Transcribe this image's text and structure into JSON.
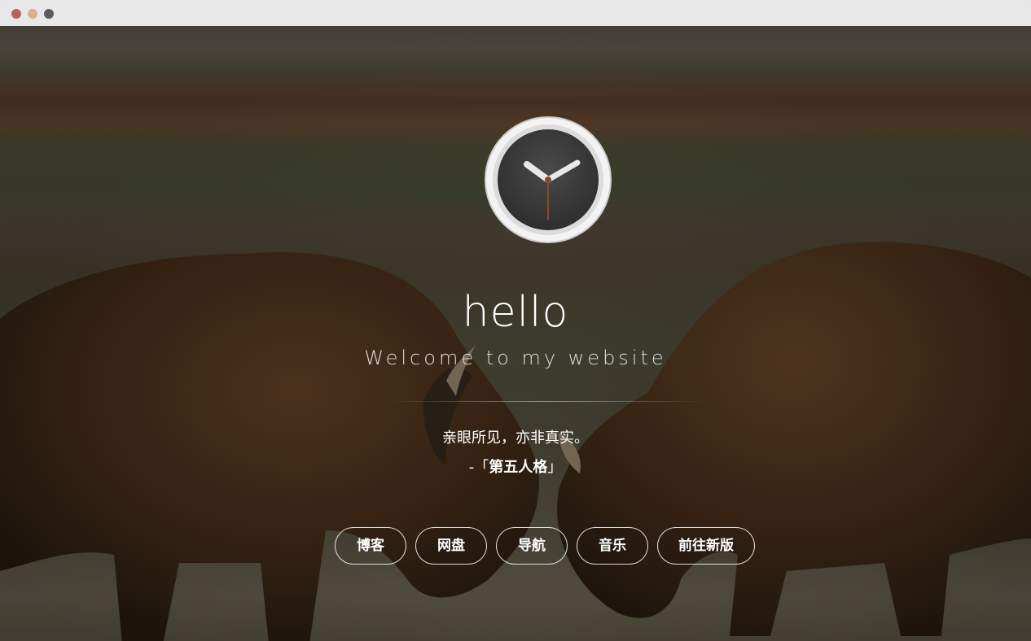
{
  "window": {
    "traffic_lights": [
      "#b6645a",
      "#d9b28b",
      "#5b5b5b"
    ]
  },
  "hero": {
    "title": "hello",
    "subtitle": "Welcome to my website",
    "quote": "亲眼所见，亦非真实。",
    "attribution_prefix": "-「",
    "attribution_name": "第五人格",
    "attribution_suffix": "」"
  },
  "nav": {
    "buttons": [
      {
        "label": "博客"
      },
      {
        "label": "网盘"
      },
      {
        "label": "导航"
      },
      {
        "label": "音乐"
      },
      {
        "label": "前往新版"
      }
    ]
  },
  "clock": {
    "icon": "clock-icon"
  }
}
